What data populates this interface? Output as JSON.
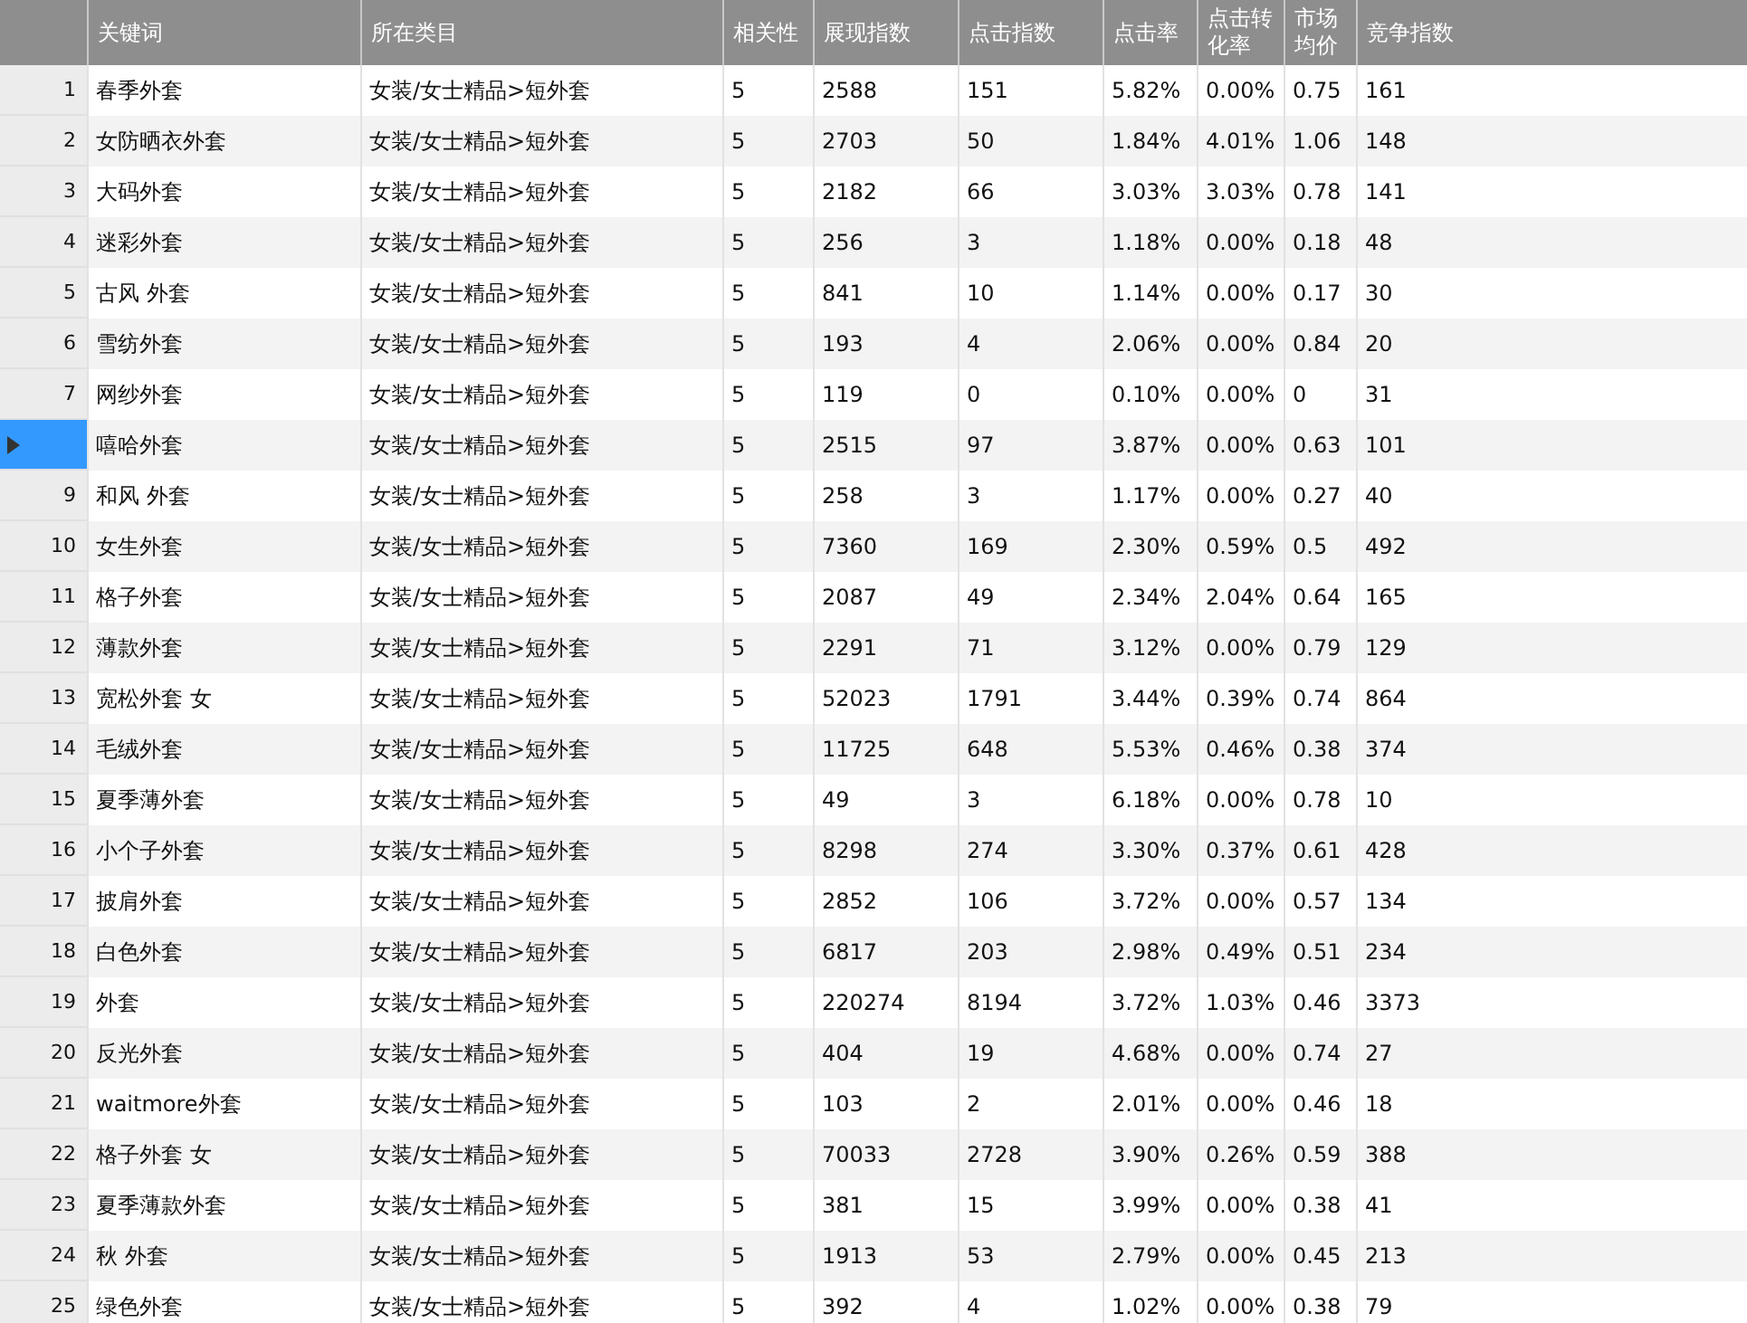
{
  "table": {
    "columns": [
      "关键词",
      "所在类目",
      "相关性",
      "展现指数",
      "点击指数",
      "点击率",
      "点击转化率",
      "市场均价",
      "竞争指数"
    ],
    "rows": [
      {
        "num": "1",
        "selected": false,
        "cells": [
          "春季外套",
          "女装/女士精品>短外套",
          "5",
          "2588",
          "151",
          "5.82%",
          "0.00%",
          "0.75",
          "161"
        ]
      },
      {
        "num": "2",
        "selected": false,
        "cells": [
          "女防晒衣外套",
          "女装/女士精品>短外套",
          "5",
          "2703",
          "50",
          "1.84%",
          "4.01%",
          "1.06",
          "148"
        ]
      },
      {
        "num": "3",
        "selected": false,
        "cells": [
          "大码外套",
          "女装/女士精品>短外套",
          "5",
          "2182",
          "66",
          "3.03%",
          "3.03%",
          "0.78",
          "141"
        ]
      },
      {
        "num": "4",
        "selected": false,
        "cells": [
          "迷彩外套",
          "女装/女士精品>短外套",
          "5",
          "256",
          "3",
          "1.18%",
          "0.00%",
          "0.18",
          "48"
        ]
      },
      {
        "num": "5",
        "selected": false,
        "cells": [
          "古风 外套",
          "女装/女士精品>短外套",
          "5",
          "841",
          "10",
          "1.14%",
          "0.00%",
          "0.17",
          "30"
        ]
      },
      {
        "num": "6",
        "selected": false,
        "cells": [
          "雪纺外套",
          "女装/女士精品>短外套",
          "5",
          "193",
          "4",
          "2.06%",
          "0.00%",
          "0.84",
          "20"
        ]
      },
      {
        "num": "7",
        "selected": false,
        "cells": [
          "网纱外套",
          "女装/女士精品>短外套",
          "5",
          "119",
          "0",
          "0.10%",
          "0.00%",
          "0",
          "31"
        ]
      },
      {
        "selected": true,
        "cells": [
          "嘻哈外套",
          "女装/女士精品>短外套",
          "5",
          "2515",
          "97",
          "3.87%",
          "0.00%",
          "0.63",
          "101"
        ]
      },
      {
        "num": "9",
        "selected": false,
        "cells": [
          "和风 外套",
          "女装/女士精品>短外套",
          "5",
          "258",
          "3",
          "1.17%",
          "0.00%",
          "0.27",
          "40"
        ]
      },
      {
        "num": "10",
        "selected": false,
        "cells": [
          "女生外套",
          "女装/女士精品>短外套",
          "5",
          "7360",
          "169",
          "2.30%",
          "0.59%",
          "0.5",
          "492"
        ]
      },
      {
        "num": "11",
        "selected": false,
        "cells": [
          "格子外套",
          "女装/女士精品>短外套",
          "5",
          "2087",
          "49",
          "2.34%",
          "2.04%",
          "0.64",
          "165"
        ]
      },
      {
        "num": "12",
        "selected": false,
        "cells": [
          "薄款外套",
          "女装/女士精品>短外套",
          "5",
          "2291",
          "71",
          "3.12%",
          "0.00%",
          "0.79",
          "129"
        ]
      },
      {
        "num": "13",
        "selected": false,
        "cells": [
          "宽松外套 女",
          "女装/女士精品>短外套",
          "5",
          "52023",
          "1791",
          "3.44%",
          "0.39%",
          "0.74",
          "864"
        ]
      },
      {
        "num": "14",
        "selected": false,
        "cells": [
          "毛绒外套",
          "女装/女士精品>短外套",
          "5",
          "11725",
          "648",
          "5.53%",
          "0.46%",
          "0.38",
          "374"
        ]
      },
      {
        "num": "15",
        "selected": false,
        "cells": [
          "夏季薄外套",
          "女装/女士精品>短外套",
          "5",
          "49",
          "3",
          "6.18%",
          "0.00%",
          "0.78",
          "10"
        ]
      },
      {
        "num": "16",
        "selected": false,
        "cells": [
          "小个子外套",
          "女装/女士精品>短外套",
          "5",
          "8298",
          "274",
          "3.30%",
          "0.37%",
          "0.61",
          "428"
        ]
      },
      {
        "num": "17",
        "selected": false,
        "cells": [
          "披肩外套",
          "女装/女士精品>短外套",
          "5",
          "2852",
          "106",
          "3.72%",
          "0.00%",
          "0.57",
          "134"
        ]
      },
      {
        "num": "18",
        "selected": false,
        "cells": [
          "白色外套",
          "女装/女士精品>短外套",
          "5",
          "6817",
          "203",
          "2.98%",
          "0.49%",
          "0.51",
          "234"
        ]
      },
      {
        "num": "19",
        "selected": false,
        "cells": [
          "外套",
          "女装/女士精品>短外套",
          "5",
          "220274",
          "8194",
          "3.72%",
          "1.03%",
          "0.46",
          "3373"
        ]
      },
      {
        "num": "20",
        "selected": false,
        "cells": [
          "反光外套",
          "女装/女士精品>短外套",
          "5",
          "404",
          "19",
          "4.68%",
          "0.00%",
          "0.74",
          "27"
        ]
      },
      {
        "num": "21",
        "selected": false,
        "cells": [
          "waitmore外套",
          "女装/女士精品>短外套",
          "5",
          "103",
          "2",
          "2.01%",
          "0.00%",
          "0.46",
          "18"
        ]
      },
      {
        "num": "22",
        "selected": false,
        "cells": [
          "格子外套 女",
          "女装/女士精品>短外套",
          "5",
          "70033",
          "2728",
          "3.90%",
          "0.26%",
          "0.59",
          "388"
        ]
      },
      {
        "num": "23",
        "selected": false,
        "cells": [
          "夏季薄款外套",
          "女装/女士精品>短外套",
          "5",
          "381",
          "15",
          "3.99%",
          "0.00%",
          "0.38",
          "41"
        ]
      },
      {
        "num": "24",
        "selected": false,
        "cells": [
          "秋 外套",
          "女装/女士精品>短外套",
          "5",
          "1913",
          "53",
          "2.79%",
          "0.00%",
          "0.45",
          "213"
        ]
      },
      {
        "num": "25",
        "selected": false,
        "cells": [
          "绿色外套",
          "女装/女士精品>短外套",
          "5",
          "392",
          "4",
          "1.02%",
          "0.00%",
          "0.38",
          "79"
        ]
      }
    ]
  }
}
